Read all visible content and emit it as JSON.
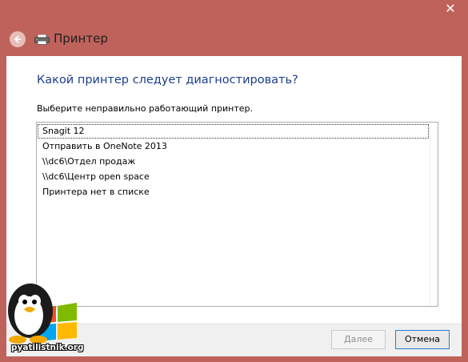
{
  "window": {
    "close_glyph": "✕",
    "title": "Принтер"
  },
  "icons": {
    "back": "back-arrow-icon",
    "printer": "printer-icon",
    "close": "close-icon"
  },
  "main": {
    "heading": "Какой принтер следует диагностировать?",
    "instruction": "Выберите неправильно работающий принтер.",
    "printers": [
      "Snagit 12",
      "Отправить в OneNote 2013",
      "\\\\dc6\\Отдел продаж",
      "\\\\dc6\\Центр open space",
      "Принтера нет в списке"
    ],
    "selected_index": 0
  },
  "footer": {
    "next_label": "Далее",
    "cancel_label": "Отмена",
    "next_enabled": false
  },
  "watermark": {
    "text": "pyatilistnik.org"
  },
  "colors": {
    "frame": "#c0625c",
    "heading": "#1a3e8a",
    "focus_border": "#2b79d4"
  }
}
